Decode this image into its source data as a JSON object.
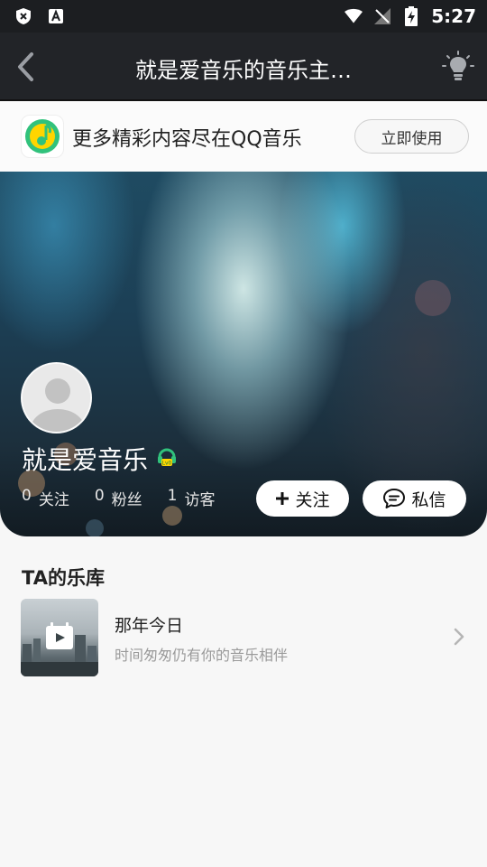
{
  "status_bar": {
    "time": "5:27",
    "icons": [
      "shield-x-icon",
      "a-icon",
      "wifi-icon",
      "no-signal-icon",
      "battery-charging-icon"
    ]
  },
  "nav": {
    "title": "就是爱音乐的音乐主…",
    "icons": [
      "back-icon",
      "bulb-icon"
    ]
  },
  "promo": {
    "text": "更多精彩内容尽在QQ音乐",
    "button_label": "立即使用"
  },
  "profile": {
    "name": "就是爱音乐",
    "level_badge": "Lv0",
    "stats": [
      {
        "count": "0",
        "label": "关注"
      },
      {
        "count": "0",
        "label": "粉丝"
      },
      {
        "count": "1",
        "label": "访客"
      }
    ],
    "follow_label": "关注",
    "message_label": "私信"
  },
  "library": {
    "title": "TA的乐库",
    "items": [
      {
        "title": "那年今日",
        "subtitle": "时间匆匆仍有你的音乐相伴"
      }
    ]
  },
  "colors": {
    "nav_bg": "#222428",
    "page_bg": "#f7f7f7",
    "qq_green": "#31c27c",
    "qq_yellow": "#ffd500"
  }
}
